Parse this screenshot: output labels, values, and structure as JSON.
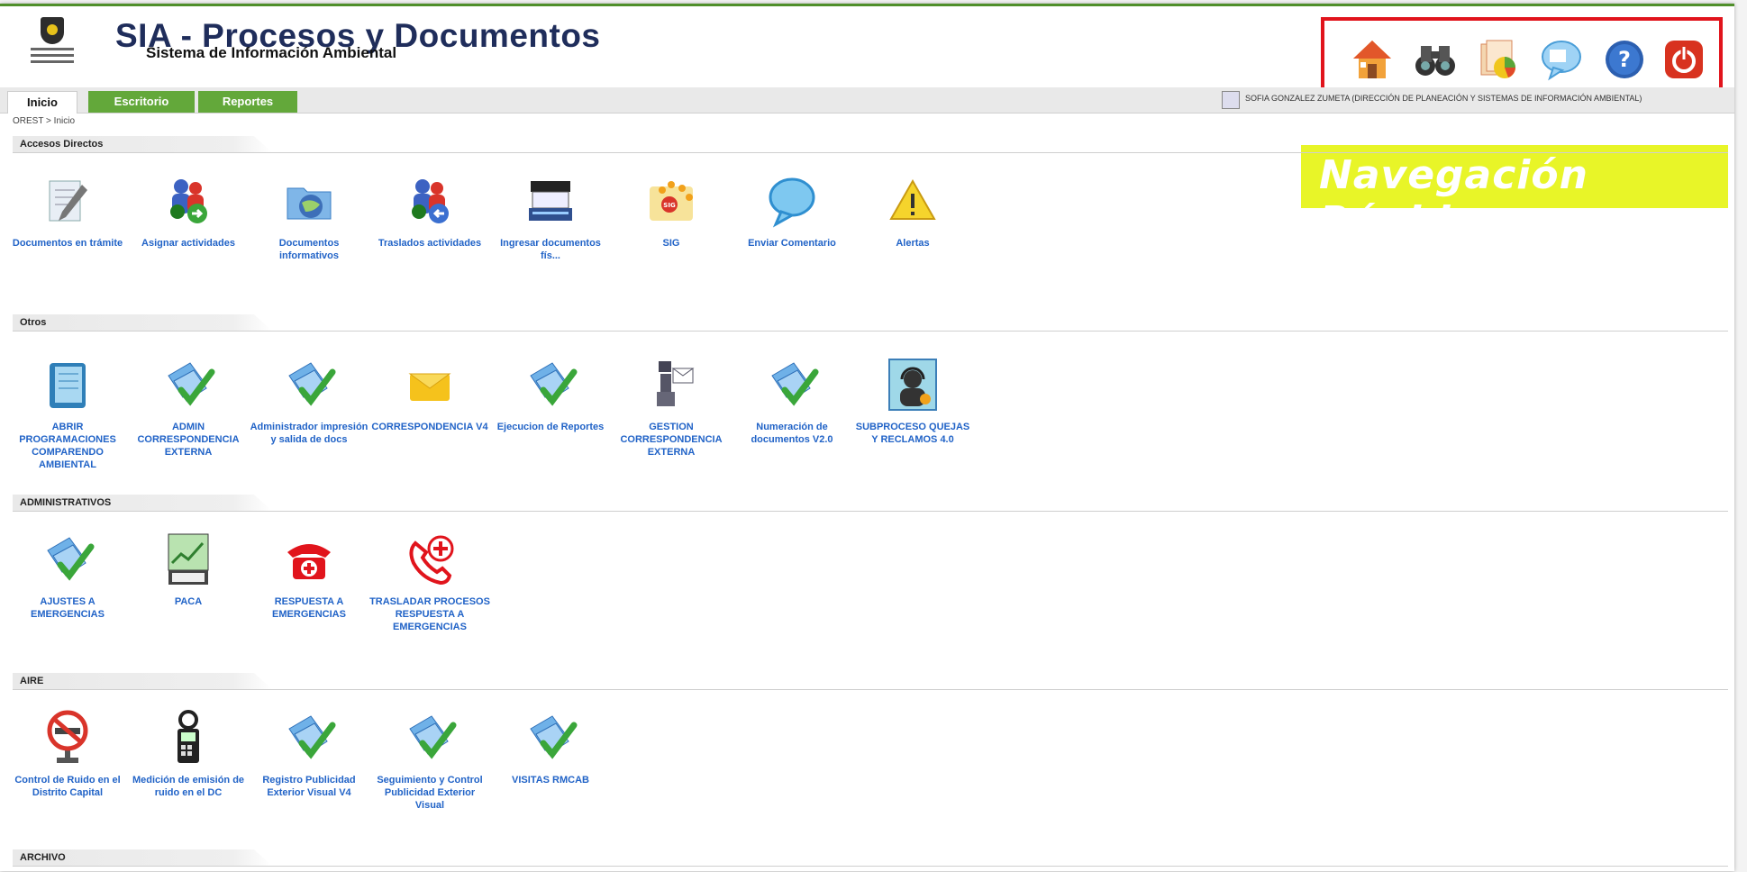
{
  "header": {
    "title": "SIA - Procesos y Documentos",
    "subtitle": "Sistema de Información Ambiental"
  },
  "quick_nav": {
    "banner": "Navegación Rápida",
    "icons": [
      "home-icon",
      "binoculars-icon",
      "reports-icon",
      "comment-icon",
      "help-icon",
      "power-icon"
    ]
  },
  "tabs": [
    {
      "label": "Inicio",
      "active": true
    },
    {
      "label": "Escritorio",
      "active": false
    },
    {
      "label": "Reportes",
      "active": false
    }
  ],
  "user": {
    "text": "SOFIA GONZALEZ ZUMETA (DIRECCIÓN DE PLANEACIÓN Y SISTEMAS DE INFORMACIÓN AMBIENTAL)"
  },
  "breadcrumb": "OREST > Inicio",
  "sections": [
    {
      "title": "Accesos Directos",
      "items": [
        {
          "label": "Documentos en trámite",
          "icon": "document-pen-icon"
        },
        {
          "label": "Asignar actividades",
          "icon": "users-assign-icon"
        },
        {
          "label": "Documentos informativos",
          "icon": "folder-globe-icon"
        },
        {
          "label": "Traslados actividades",
          "icon": "users-transfer-icon"
        },
        {
          "label": "Ingresar documentos fís...",
          "icon": "scanner-icon"
        },
        {
          "label": "SIG",
          "icon": "sig-icon"
        },
        {
          "label": "Enviar Comentario",
          "icon": "speech-bubble-icon"
        },
        {
          "label": "Alertas",
          "icon": "warning-icon"
        }
      ]
    },
    {
      "title": "Otros",
      "items": [
        {
          "label": "ABRIR PROGRAMACIONES COMPARENDO AMBIENTAL",
          "icon": "notebook-icon"
        },
        {
          "label": "ADMIN CORRESPONDENCIA EXTERNA",
          "icon": "doc-check-icon"
        },
        {
          "label": "Administrador impresión y salida de docs",
          "icon": "doc-check-icon"
        },
        {
          "label": "CORRESPONDENCIA V4",
          "icon": "envelope-icon"
        },
        {
          "label": "Ejecucion de Reportes",
          "icon": "doc-check-icon"
        },
        {
          "label": "GESTION CORRESPONDENCIA EXTERNA",
          "icon": "robot-mail-icon"
        },
        {
          "label": "Numeración de documentos V2.0",
          "icon": "doc-check-icon"
        },
        {
          "label": "SUBPROCESO QUEJAS Y RECLAMOS 4.0",
          "icon": "support-agent-icon"
        }
      ]
    },
    {
      "title": "ADMINISTRATIVOS",
      "items": [
        {
          "label": "AJUSTES A EMERGENCIAS",
          "icon": "doc-check-icon"
        },
        {
          "label": "PACA",
          "icon": "paca-icon"
        },
        {
          "label": "RESPUESTA A EMERGENCIAS",
          "icon": "emergency-phone-icon"
        },
        {
          "label": "TRASLADAR PROCESOS RESPUESTA A EMERGENCIAS",
          "icon": "phone-plus-icon"
        }
      ]
    },
    {
      "title": "AIRE",
      "items": [
        {
          "label": "Control de Ruido en el Distrito Capital",
          "icon": "no-honk-sign-icon"
        },
        {
          "label": "Medición de emisión de ruido en el DC",
          "icon": "sound-meter-icon"
        },
        {
          "label": "Registro Publicidad Exterior Visual V4",
          "icon": "doc-check-icon"
        },
        {
          "label": "Seguimiento y Control Publicidad Exterior Visual",
          "icon": "doc-check-icon"
        },
        {
          "label": "VISITAS RMCAB",
          "icon": "doc-check-icon"
        }
      ]
    },
    {
      "title": "ARCHIVO",
      "items": []
    }
  ]
}
